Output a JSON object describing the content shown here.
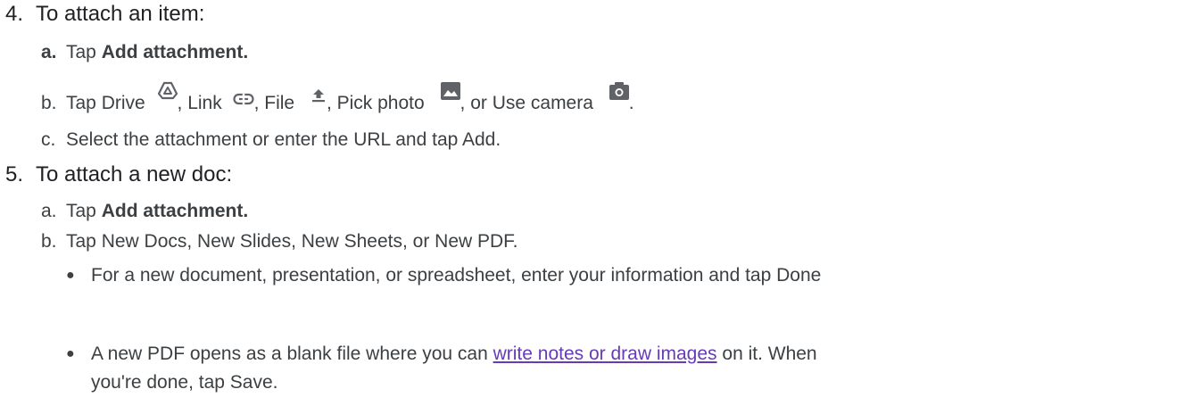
{
  "step4": {
    "number": "4.",
    "title": "To attach an item:",
    "a": {
      "marker": "a.",
      "prefix": "Tap",
      "bold": "Add attachment."
    },
    "b": {
      "marker": "b.",
      "prefix": "Tap Drive",
      "after_drive": ", Link",
      "after_link": ", File",
      "after_file": ",  Pick photo",
      "after_photo": ", or Use camera",
      "end": "."
    },
    "c": {
      "marker": "c.",
      "text": "Select the attachment or enter the URL and tap Add."
    }
  },
  "step5": {
    "number": "5.",
    "title": "To attach a new doc:",
    "a": {
      "marker": "a.",
      "prefix": "Tap",
      "bold": "Add attachment."
    },
    "b": {
      "marker": "b.",
      "text": "Tap New Docs, New Slides, New Sheets, or New PDF."
    },
    "bullets": {
      "marker": "●",
      "first": "For a new document, presentation, or spreadsheet, enter your information and tap Done",
      "second_before_link": "A new PDF opens as a blank file where you can",
      "second_link": "write notes or draw images",
      "second_after_link": "on it. When",
      "second_line2": "you're done, tap Save."
    }
  },
  "icons": {
    "drive": "drive-icon",
    "link": "link-icon",
    "file": "upload-icon",
    "photo": "image-icon",
    "camera": "camera-icon"
  },
  "colors": {
    "text": "#3c4043",
    "heading": "#202124",
    "link": "#673ab7",
    "icon": "#5f6368"
  }
}
